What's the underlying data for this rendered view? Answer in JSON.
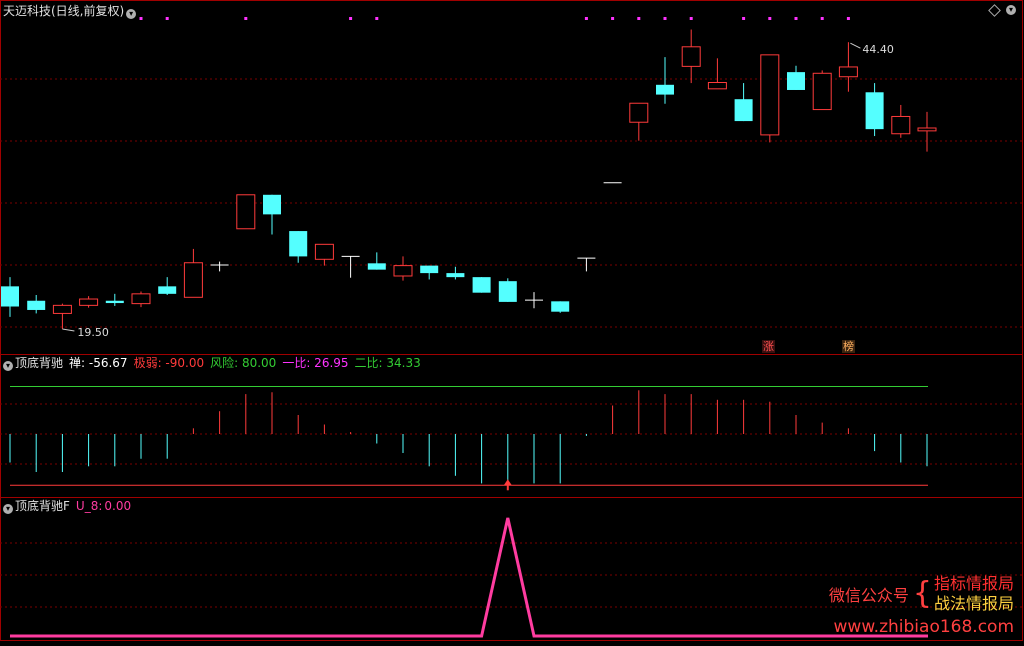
{
  "colors": {
    "up": "#ff3b3b",
    "down": "#54ffff",
    "doji": "#ffffff",
    "grid": "#7a0000",
    "border": "#a00000",
    "text": "#c8c8c8",
    "marker": "#ff33ff",
    "spike": "#ff3ca0",
    "green": "#33cc33",
    "magenta": "#ff33ff",
    "orange_label": "#ffa040"
  },
  "main": {
    "title": "天迈科技(日线,前复权)",
    "expand_icon": "chevron-down-icon",
    "high_label": "44.40",
    "low_label": "19.50",
    "badge_zhang": "涨",
    "badge_bang": "榜",
    "top_right_icon": "diamond-icon"
  },
  "ind1": {
    "name": "顶底背驰",
    "items": [
      {
        "label": "禅:",
        "value": "-56.67",
        "color": "#ffffff"
      },
      {
        "label": "极弱:",
        "value": "-90.00",
        "color": "#ff3b3b"
      },
      {
        "label": "风险:",
        "value": "80.00",
        "color": "#33cc33"
      },
      {
        "label": "一比:",
        "value": "26.95",
        "color": "#ff33ff"
      },
      {
        "label": "二比:",
        "value": "34.33",
        "color": "#33cc33"
      }
    ],
    "risk_level": 80,
    "weak_level": -90
  },
  "ind2": {
    "name": "顶底背驰F",
    "label": "U_8:",
    "value": "0.00"
  },
  "watermark": {
    "left_text": "微信公众号",
    "line1": "指标情报局",
    "line2": "战法情报局",
    "url": "www.zhibiao168.com"
  },
  "chart_data": {
    "type": "candlestick",
    "title": "天迈科技(日线,前复权)",
    "ylim": [
      17.5,
      46.5
    ],
    "candles": [
      {
        "o": 23.2,
        "c": 21.45,
        "h": 24.0,
        "l": 20.55
      },
      {
        "o": 21.95,
        "c": 21.15,
        "h": 22.45,
        "l": 20.85
      },
      {
        "o": 20.85,
        "c": 21.55,
        "h": 21.7,
        "l": 19.5
      },
      {
        "o": 21.55,
        "c": 22.1,
        "h": 22.35,
        "l": 21.35
      },
      {
        "o": 21.95,
        "c": 21.75,
        "h": 22.55,
        "l": 21.5
      },
      {
        "o": 21.7,
        "c": 22.55,
        "h": 22.75,
        "l": 21.4
      },
      {
        "o": 23.2,
        "c": 22.55,
        "h": 24.0,
        "l": 22.45
      },
      {
        "o": 22.25,
        "c": 25.25,
        "h": 26.45,
        "l": 22.25
      },
      {
        "o": 25.05,
        "c": 25.05,
        "h": 25.35,
        "l": 24.5
      },
      {
        "o": 28.2,
        "c": 31.15,
        "h": 31.15,
        "l": 28.2
      },
      {
        "o": 31.15,
        "c": 29.45,
        "h": 31.15,
        "l": 27.7
      },
      {
        "o": 28.0,
        "c": 25.8,
        "h": 28.0,
        "l": 25.25
      },
      {
        "o": 25.55,
        "c": 26.85,
        "h": 26.85,
        "l": 25.0
      },
      {
        "o": 25.8,
        "c": 25.8,
        "h": 25.8,
        "l": 23.95
      },
      {
        "o": 25.2,
        "c": 24.65,
        "h": 26.15,
        "l": 24.65
      },
      {
        "o": 24.1,
        "c": 25.0,
        "h": 25.8,
        "l": 23.7
      },
      {
        "o": 25.0,
        "c": 24.35,
        "h": 25.0,
        "l": 23.8
      },
      {
        "o": 24.35,
        "c": 24.0,
        "h": 24.9,
        "l": 23.8
      },
      {
        "o": 24.0,
        "c": 22.65,
        "h": 24.0,
        "l": 22.65
      },
      {
        "o": 23.65,
        "c": 21.85,
        "h": 23.9,
        "l": 21.85
      },
      {
        "o": 22.0,
        "c": 22.0,
        "h": 22.7,
        "l": 21.3
      },
      {
        "o": 21.9,
        "c": 21.0,
        "h": 21.9,
        "l": 20.9
      },
      {
        "o": 25.65,
        "c": 25.65,
        "h": 25.65,
        "l": 24.5
      },
      {
        "o": 32.2,
        "c": 32.2,
        "h": 32.2,
        "l": 32.2
      },
      {
        "o": 37.45,
        "c": 39.1,
        "h": 39.1,
        "l": 35.85
      },
      {
        "o": 40.7,
        "c": 39.85,
        "h": 43.1,
        "l": 39.05
      },
      {
        "o": 42.3,
        "c": 44.0,
        "h": 45.5,
        "l": 40.85
      },
      {
        "o": 40.35,
        "c": 40.9,
        "h": 43.0,
        "l": 40.35
      },
      {
        "o": 39.45,
        "c": 37.55,
        "h": 40.85,
        "l": 37.55
      },
      {
        "o": 36.35,
        "c": 43.3,
        "h": 43.3,
        "l": 35.7
      },
      {
        "o": 41.8,
        "c": 40.25,
        "h": 42.35,
        "l": 40.25
      },
      {
        "o": 38.55,
        "c": 41.7,
        "h": 41.95,
        "l": 38.55
      },
      {
        "o": 41.4,
        "c": 42.25,
        "h": 44.4,
        "l": 40.1
      },
      {
        "o": 40.05,
        "c": 36.85,
        "h": 40.85,
        "l": 36.25
      },
      {
        "o": 36.45,
        "c": 37.95,
        "h": 38.95,
        "l": 36.1
      },
      {
        "o": 36.7,
        "c": 36.95,
        "h": 38.35,
        "l": 34.9
      }
    ],
    "indicator1": {
      "name": "顶底背驰",
      "bars": [
        -1.5,
        -2,
        -2,
        -1.7,
        -1.7,
        -1.3,
        -1.3,
        0.3,
        1.2,
        2.1,
        2.2,
        1,
        0.5,
        0.1,
        -0.5,
        -1,
        -1.7,
        -2.2,
        -2.6,
        -2.5,
        -2.6,
        -2.6,
        -0.1,
        1.5,
        2.3,
        2.1,
        2.1,
        1.8,
        1.8,
        1.7,
        1,
        0.6,
        0.3,
        -0.9,
        -1.5,
        -1.7
      ],
      "upper_line": 2.5,
      "lower_line": -2.7,
      "arrow_bar_index": 19
    },
    "indicator2": {
      "name": "顶底背驰F",
      "values": [
        0,
        0,
        0,
        0,
        0,
        0,
        0,
        0,
        0,
        0,
        0,
        0,
        0,
        0,
        0,
        0,
        0,
        0,
        0,
        1,
        0,
        0,
        0,
        0,
        0,
        0,
        0,
        0,
        0,
        0,
        0,
        0,
        0,
        0,
        0,
        0
      ]
    }
  }
}
